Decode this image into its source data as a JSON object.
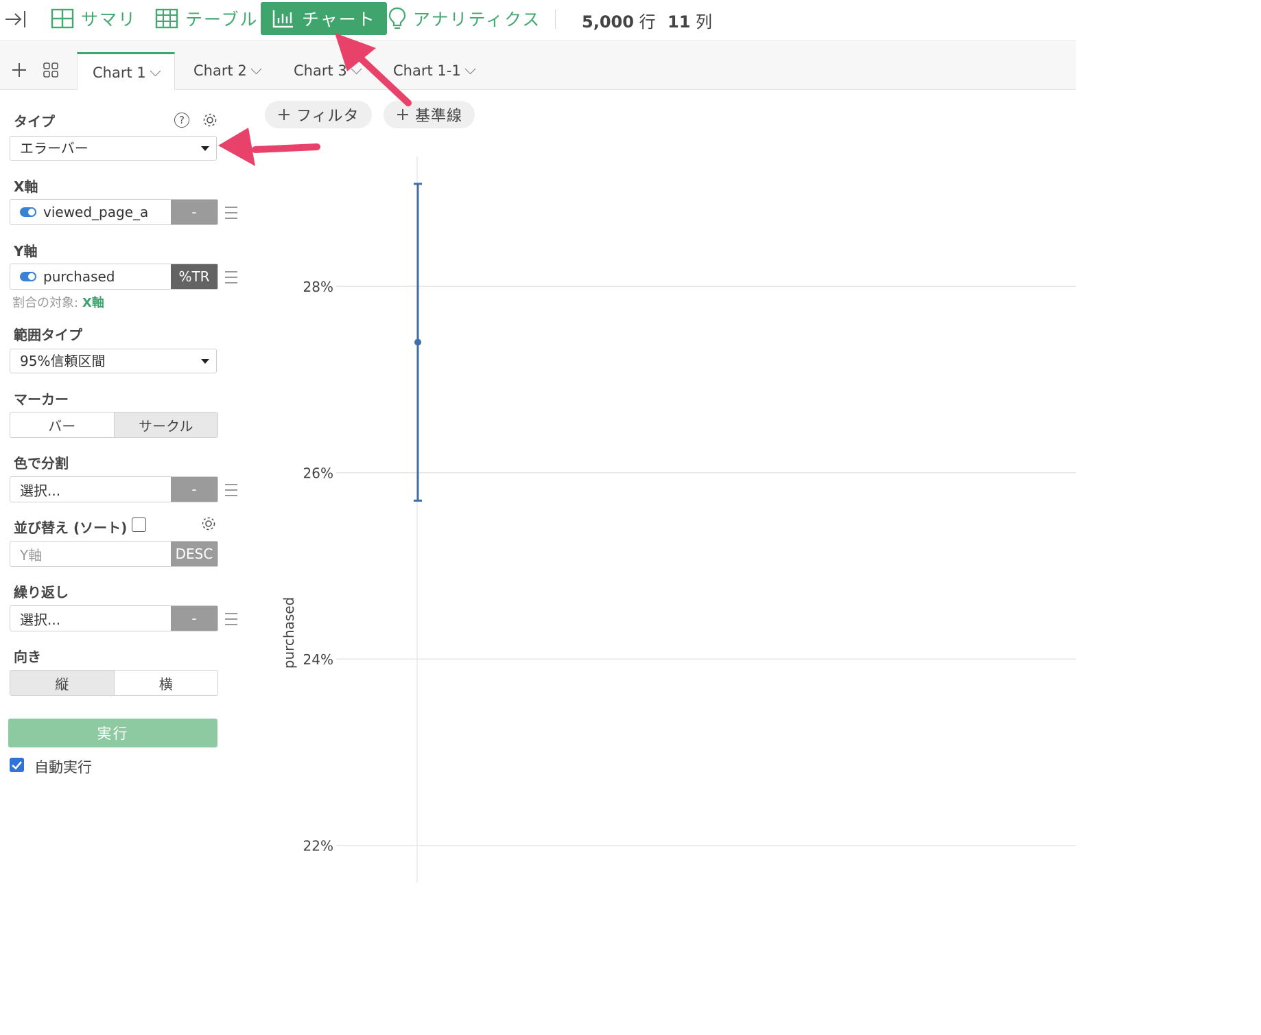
{
  "toolbar": {
    "summary": "サマリ",
    "table": "テーブル",
    "chart": "チャート",
    "analytics": "アナリティクス",
    "rows_num": "5,000",
    "rows_unit": "行",
    "cols_num": "11",
    "cols_unit": "列"
  },
  "tabs": [
    "Chart 1",
    "Chart 2",
    "Chart 3",
    "Chart 1-1"
  ],
  "sidebar": {
    "type_label": "タイプ",
    "type_value": "エラーバー",
    "x_label": "X軸",
    "x_field": "viewed_page_a",
    "x_agg": "-",
    "y_label": "Y軸",
    "y_field": "purchased",
    "y_agg": "%TR",
    "ratio_note": "割合の対象:",
    "ratio_target": "X軸",
    "range_label": "範囲タイプ",
    "range_value": "95%信頼区間",
    "marker_label": "マーカー",
    "marker_bar": "バー",
    "marker_circle": "サークル",
    "color_label": "色で分割",
    "color_placeholder": "選択...",
    "color_agg": "-",
    "sort_label": "並び替え (ソート)",
    "sort_field": "Y軸",
    "sort_order": "DESC",
    "repeat_label": "繰り返し",
    "repeat_placeholder": "選択...",
    "repeat_agg": "-",
    "orient_label": "向き",
    "orient_vertical": "縦",
    "orient_horizontal": "横",
    "run": "実行",
    "auto_run": "自動実行"
  },
  "chart_actions": {
    "filter": "フィルタ",
    "refline": "基準線"
  },
  "colors": {
    "accent": "#3fa56c",
    "series": "#3f6fa8",
    "annotation_arrow": "#e8426b"
  },
  "chart_data": {
    "type": "errorbar",
    "ylabel": "purchased",
    "y_ticks": [
      "22%",
      "24%",
      "26%",
      "28%"
    ],
    "y_tick_values": [
      22,
      24,
      26,
      28
    ],
    "ylim": [
      21.6,
      29.6
    ],
    "grid": true,
    "points": [
      {
        "mean": 27.4,
        "lower": 25.7,
        "upper": 29.1
      }
    ]
  }
}
